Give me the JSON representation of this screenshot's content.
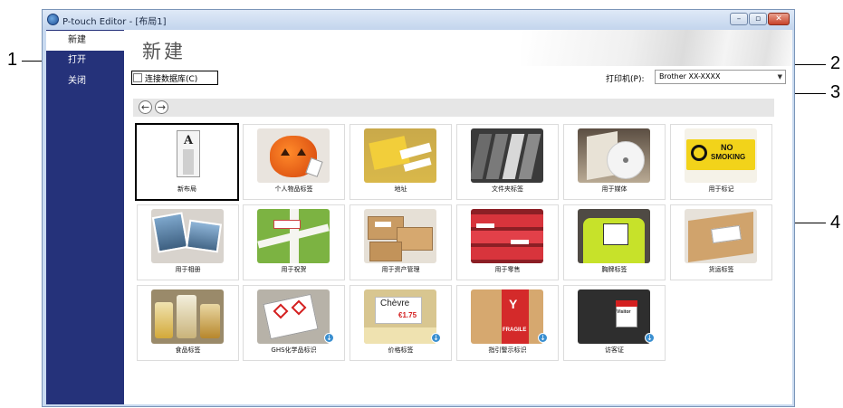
{
  "window": {
    "title": "P-touch Editor - [布局1]",
    "controls": [
      "–",
      "▫",
      "✕"
    ]
  },
  "sidebar": {
    "items": [
      {
        "label": "新建",
        "active": true
      },
      {
        "label": "打开",
        "active": false
      },
      {
        "label": "关闭",
        "active": false
      }
    ]
  },
  "main": {
    "title": "新建",
    "database_checkbox_label": "连接数据库(C)",
    "printer_label": "打印机(P):",
    "printer_value": "Brother XX-XXXX"
  },
  "navigation": {
    "back": "←",
    "forward": "→"
  },
  "templates": [
    {
      "label": "新布局",
      "icon": "new-layout-icon"
    },
    {
      "label": "个人物品标签",
      "icon": "pumpkin-image"
    },
    {
      "label": "地址",
      "icon": "address-labels-image"
    },
    {
      "label": "文件夹标签",
      "icon": "folder-labels-image"
    },
    {
      "label": "用于媒体",
      "icon": "media-disc-image"
    },
    {
      "label": "用于标记",
      "icon": "no-smoking-sign-image"
    },
    {
      "label": "用于相册",
      "icon": "photo-album-image"
    },
    {
      "label": "用于祝贺",
      "icon": "gift-box-image"
    },
    {
      "label": "用于资产管理",
      "icon": "asset-boxes-image"
    },
    {
      "label": "用于零售",
      "icon": "retail-shelves-image"
    },
    {
      "label": "胸牌标签",
      "icon": "badge-vest-image"
    },
    {
      "label": "货运标签",
      "icon": "shipping-box-image"
    },
    {
      "label": "食品标签",
      "icon": "food-jars-image"
    },
    {
      "label": "GHS化学品标识",
      "icon": "ghs-chemical-image"
    },
    {
      "label": "价格标签",
      "icon": "price-tag-image"
    },
    {
      "label": "指引警示标识",
      "icon": "fragile-box-image"
    },
    {
      "label": "访客证",
      "icon": "visitor-badge-image"
    }
  ],
  "image_text": {
    "no_smoking_line1": "NO",
    "no_smoking_line2": "SMOKING",
    "chevre": "Chèvre",
    "price": "€1.75",
    "fragile": "FRAGILE",
    "visitor": "Visitor"
  },
  "callouts": [
    "1",
    "2",
    "3",
    "4"
  ],
  "colors": {
    "sidebar": "#25327a",
    "titlebar": "#c3d5ed",
    "close_button": "#c8432a"
  }
}
